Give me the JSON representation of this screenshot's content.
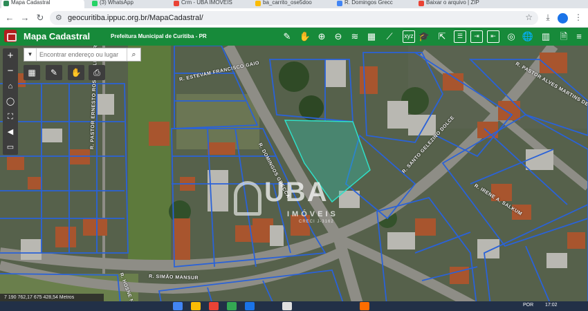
{
  "browser": {
    "tabs": [
      {
        "label": "Mapa Cadastral",
        "active": true,
        "color": "#2e8b57"
      },
      {
        "label": "(3) WhatsApp",
        "active": false,
        "color": "#25d366"
      },
      {
        "label": "Crm - UBA IMÓVEIS",
        "active": false,
        "color": "#ea4335"
      },
      {
        "label": "ba_carrito_ose5doo",
        "active": false,
        "color": "#fbbc05"
      },
      {
        "label": "R. Domingos Grecc",
        "active": false,
        "color": "#4285f4"
      },
      {
        "label": "Baixar o arquivo | ZIP",
        "active": false,
        "color": "#ea4335"
      }
    ],
    "url": "geocuritiba.ippuc.org.br/MapaCadastral/"
  },
  "app": {
    "title": "Mapa Cadastral",
    "subtitle": "Prefeitura Municipal de Curitiba - PR",
    "header_color": "#178a3a"
  },
  "search": {
    "placeholder": "Encontrar endereço ou lugar"
  },
  "streets": [
    "R. ESTEVAM FRANCISCO GAIO",
    "R. PASTOR ALVES MARTINS DE ALMEIDA",
    "R. PASTOR ERNESTO ROSENFELD GARCIA",
    "R. DOMINGOS GRECCA",
    "R. SANTO GELEZINO DOLCE",
    "R. IRENE A. SALKUM",
    "R. SIMÃO MANSUR",
    "R. HOSNE N..."
  ],
  "watermark": {
    "brand": "UBA",
    "sub": "IMÓVEIS",
    "creci": "CRECI J-3162"
  },
  "coordinates": "7 190 762,17 675 428,54 Metros",
  "taskbar": {
    "lang": "POR",
    "time": "17:02"
  },
  "icons": {
    "zoom_in": "plus-icon",
    "zoom_out": "minus-icon",
    "home": "home-icon",
    "locate": "locate-icon",
    "fullscreen": "fullscreen-icon",
    "back": "back-arrow-icon",
    "layers": "layers-icon"
  }
}
